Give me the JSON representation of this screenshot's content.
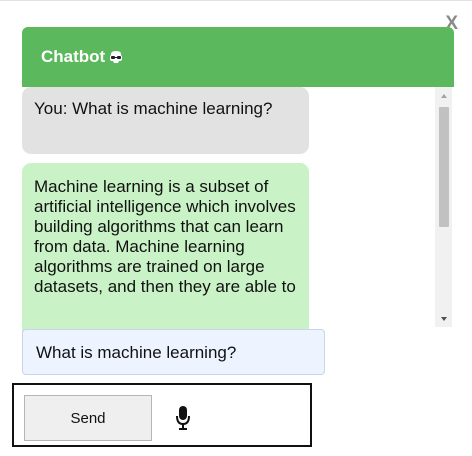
{
  "window": {
    "close_label": "X"
  },
  "header": {
    "title": "Chatbot",
    "icon": "bot-sunglasses-icon"
  },
  "messages": [
    {
      "sender": "user",
      "text": "You: What is machine learning?"
    },
    {
      "sender": "bot",
      "text": "Machine learning is a subset of artificial intelligence which involves building algorithms that can learn from data. Machine learning algorithms are trained on large datasets, and then they are able to"
    }
  ],
  "input": {
    "value": "What is machine learning?"
  },
  "controls": {
    "send_label": "Send",
    "mic_icon": "microphone-icon"
  },
  "colors": {
    "header": "#5cb85c",
    "user_bubble": "#e2e2e2",
    "bot_bubble": "#c9f3c6",
    "input_bg": "#eef4ff"
  }
}
